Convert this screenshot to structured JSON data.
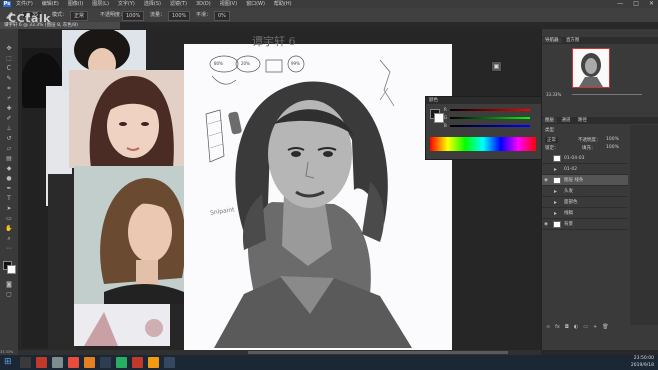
{
  "app": {
    "logo": "Ps",
    "menus": [
      "文件(F)",
      "编辑(E)",
      "图像(I)",
      "图层(L)",
      "文字(Y)",
      "选择(S)",
      "滤镜(T)",
      "3D(D)",
      "视图(V)",
      "窗口(W)",
      "帮助(H)"
    ],
    "window_controls": [
      "—",
      "□",
      "✕"
    ]
  },
  "options": {
    "mode_label": "模式：",
    "mode_value": "正常",
    "opacity_label": "不透明度：",
    "opacity_value": "100%",
    "flow_label": "流量：",
    "flow_value": "100%",
    "smooth_label": "平滑：",
    "smooth_value": "0%"
  },
  "document": {
    "tab": "谭宇轩 6 @ 33.3% (图层 8, 灰色/8)",
    "art_title": "谭宇轩 6",
    "signature": "Snipaint"
  },
  "sketch_notes": {
    "note1": "80%",
    "note2": "20%",
    "note3": "99%"
  },
  "navigator": {
    "tabs": [
      "导航器",
      "直方图"
    ],
    "zoom": "33.33%"
  },
  "color_panel": {
    "title": "颜色",
    "r": "R",
    "g": "G",
    "b": "B"
  },
  "layers_panel": {
    "tabs": [
      "图层",
      "通道",
      "路径"
    ],
    "kind_label": "类型",
    "blend_mode": "正常",
    "opacity_label": "不透明度：",
    "opacity_value": "100%",
    "lock_label": "锁定：",
    "fill_label": "填充：",
    "fill_value": "100%",
    "layers": [
      {
        "name": "01-04-03",
        "kind": "thumb"
      },
      {
        "name": "01-02",
        "kind": "folder"
      },
      {
        "name": "图层 线条",
        "kind": "thumb"
      },
      {
        "name": "头发",
        "kind": "folder"
      },
      {
        "name": "面部色",
        "kind": "folder"
      },
      {
        "name": "线稿",
        "kind": "folder"
      },
      {
        "name": "背景",
        "kind": "thumb"
      }
    ]
  },
  "status": {
    "zoom": "33.33%"
  },
  "taskbar": {
    "time": "23:50:00",
    "date": "2019/9/18"
  },
  "watermark": "CCtalk"
}
